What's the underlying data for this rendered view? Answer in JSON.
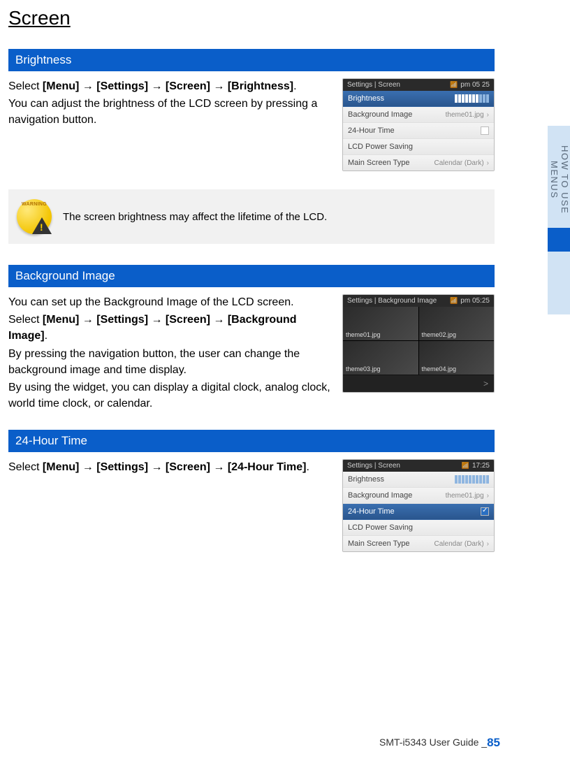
{
  "page": {
    "title": "Screen",
    "side_tab": "HOW TO USE MENUS",
    "footer_prefix": "SMT-i5343 User Guide _",
    "footer_page": "85"
  },
  "sections": {
    "brightness": {
      "header": "Brightness",
      "select_prefix": "Select ",
      "path_menu": "[Menu]",
      "path_settings": "[Settings]",
      "path_screen": "[Screen]",
      "path_target": "[Brightness]",
      "arrow": " → ",
      "period": ".",
      "body2": "You can adjust the brightness of the LCD screen by pressing a navigation button."
    },
    "warning": {
      "label": "WARNING",
      "text": "The screen brightness may affect the lifetime of the LCD."
    },
    "bgimage": {
      "header": "Background Image",
      "body1": "You can set up the Background Image of the LCD screen.",
      "select_prefix": "Select ",
      "path_menu": "[Menu]",
      "path_settings": "[Settings]",
      "path_screen": "[Screen]",
      "path_target": "[Background Image]",
      "arrow": " → ",
      "period": ".",
      "body3": "By pressing the navigation button, the user can change the background image and time display.",
      "body4": "By using the widget, you can display a digital clock, analog clock, world time clock, or calendar."
    },
    "time24": {
      "header": "24-Hour Time",
      "select_prefix": "Select ",
      "path_menu": "[Menu]",
      "path_settings": "[Settings]",
      "path_screen": "[Screen]",
      "path_target": "[24-Hour Time]",
      "arrow": " → ",
      "period": "."
    }
  },
  "shots": {
    "s1": {
      "breadcrumb": "Settings | Screen",
      "time": "pm 05 25",
      "rows": {
        "brightness": "Brightness",
        "bg": "Background Image",
        "bg_val": "theme01.jpg",
        "h24": "24-Hour Time",
        "lcd": "LCD Power Saving",
        "main": "Main Screen Type",
        "main_val": "Calendar (Dark)"
      }
    },
    "s2": {
      "breadcrumb": "Settings | Background Image",
      "time": "pm 05:25",
      "cells": {
        "a": "theme01.jpg",
        "b": "theme02.jpg",
        "c": "theme03.jpg",
        "d": "theme04.jpg"
      },
      "nav": ">"
    },
    "s3": {
      "breadcrumb": "Settings | Screen",
      "time": "17:25",
      "rows": {
        "brightness": "Brightness",
        "bg": "Background Image",
        "bg_val": "theme01.jpg",
        "h24": "24-Hour Time",
        "lcd": "LCD Power Saving",
        "main": "Main Screen Type",
        "main_val": "Calendar (Dark)"
      }
    }
  }
}
